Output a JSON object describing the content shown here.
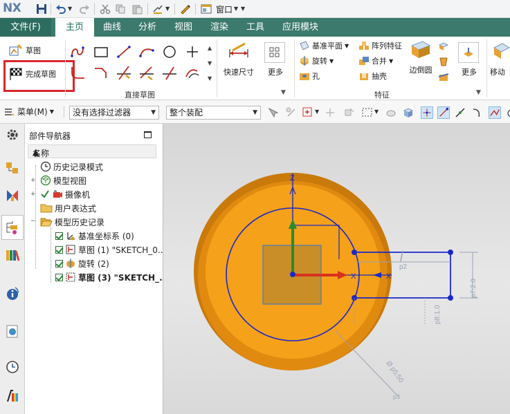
{
  "app": {
    "logo": "NX"
  },
  "title_bar": {
    "window_menu_label": "窗口"
  },
  "tabs": [
    {
      "label": "文件(F)"
    },
    {
      "label": "主页"
    },
    {
      "label": "曲线"
    },
    {
      "label": "分析"
    },
    {
      "label": "视图"
    },
    {
      "label": "渲染"
    },
    {
      "label": "工具"
    },
    {
      "label": "应用模块"
    }
  ],
  "ribbon": {
    "sketch_label": "草图",
    "finish_sketch_label": "完成草图",
    "quick_dimension_label": "快速尺寸",
    "more_label_1": "更多",
    "direct_sketch_group": "直接草图",
    "datum_plane_label": "基准平面",
    "pattern_feature_label": "阵列特征",
    "revolve_label": "旋转",
    "unite_label": "合并",
    "hole_label": "孔",
    "shell_label": "抽壳",
    "edge_blend_label": "边倒圆",
    "more_label_2": "更多",
    "feature_group": "特征",
    "move_label": "移动"
  },
  "toolbar2": {
    "menu_label": "菜单(M)",
    "filter_value": "没有选择过滤器",
    "scope_value": "整个装配"
  },
  "navigator": {
    "title": "部件导航器",
    "column_name": "名称",
    "items": [
      {
        "label": "历史记录模式"
      },
      {
        "label": "模型视图"
      },
      {
        "label": "摄像机"
      },
      {
        "label": "用户表达式"
      },
      {
        "label": "模型历史记录"
      },
      {
        "label": "基准坐标系 (0)"
      },
      {
        "label": "草图 (1) \"SKETCH_0..."
      },
      {
        "label": "旋转 (2)"
      },
      {
        "label": "草图 (3) \"SKETCH_..."
      }
    ]
  },
  "graphics": {
    "axis_z": "Z",
    "axis_x": "X",
    "axis_x2": "X",
    "dim_p2": "p2",
    "dim_p7": "p7:2.0",
    "dim_p8": "p8:1.0",
    "dim_p5": "Ø p5:50",
    "dim_p3": "p3"
  },
  "colors": {
    "tab_bar": "#3b7a6c",
    "highlight": "#d9262c",
    "part_orange": "#f5a11a",
    "sketch_blue": "#1a28c8"
  }
}
